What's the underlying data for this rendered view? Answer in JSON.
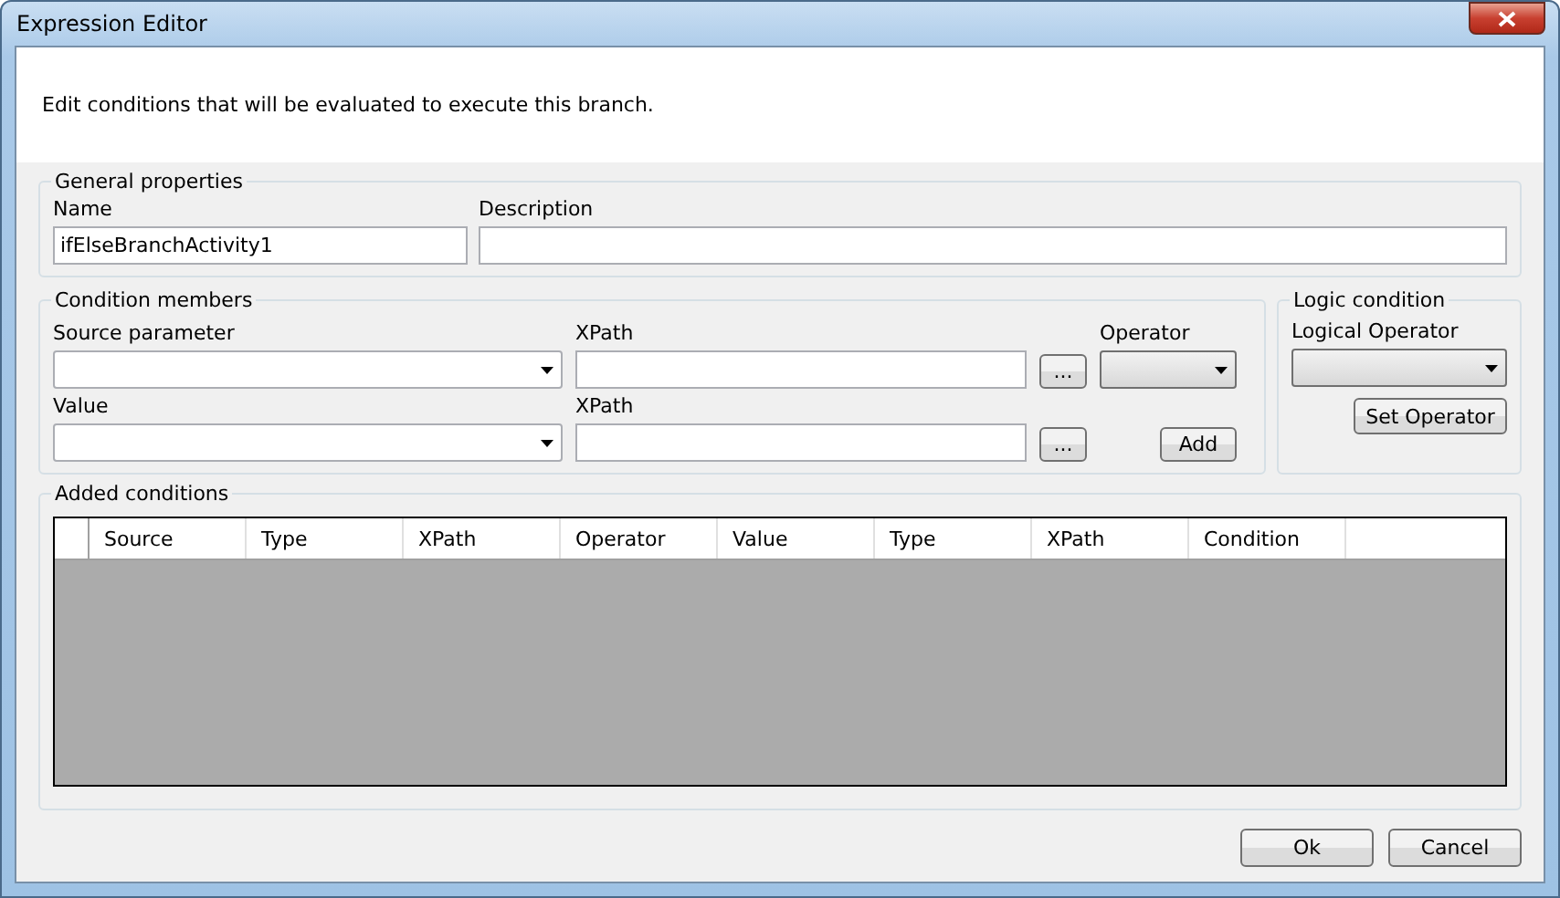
{
  "window": {
    "title": "Expression Editor"
  },
  "instruction": "Edit conditions that will be evaluated to execute this branch.",
  "general_properties": {
    "legend": "General properties",
    "name_label": "Name",
    "name_value": "ifElseBranchActivity1",
    "description_label": "Description"
  },
  "condition_members": {
    "legend": "Condition members",
    "source_label": "Source parameter",
    "xpath_label_1": "XPath",
    "browse_1": "...",
    "operator_label": "Operator",
    "value_label": "Value",
    "xpath_label_2": "XPath",
    "browse_2": "...",
    "add_button": "Add"
  },
  "logic_condition": {
    "legend": "Logic condition",
    "logical_operator_label": "Logical Operator",
    "set_operator_button": "Set Operator"
  },
  "added_conditions": {
    "legend": "Added conditions",
    "columns": [
      "Source",
      "Type",
      "XPath",
      "Operator",
      "Value",
      "Type",
      "XPath",
      "Condition"
    ]
  },
  "buttons": [
    "Ok",
    "Cancel"
  ]
}
